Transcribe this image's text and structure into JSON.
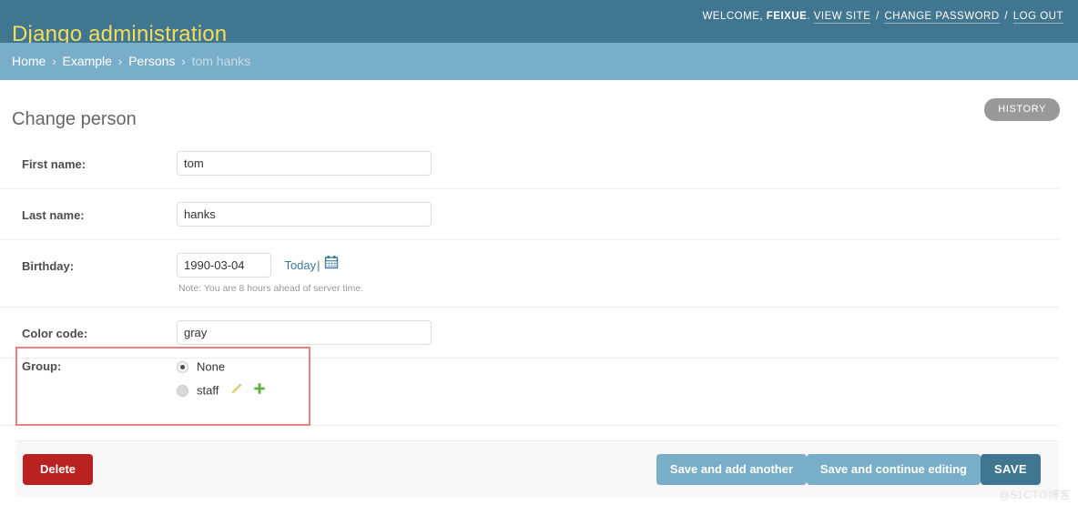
{
  "header": {
    "site_name": "Django administration",
    "welcome_prefix": "WELCOME,",
    "username": "FEIXUE",
    "username_suffix": ".",
    "view_site": "VIEW SITE",
    "sep1": "/",
    "change_password": "CHANGE PASSWORD",
    "sep2": "/",
    "log_out": "LOG OUT",
    "bg_color": "#417690",
    "title_color": "#f5dd5d"
  },
  "breadcrumbs": {
    "home": "Home",
    "sep": "›",
    "app": "Example",
    "model": "Persons",
    "current": "tom hanks",
    "bg_color": "#79aec8"
  },
  "content": {
    "title": "Change person",
    "history_button": "HISTORY"
  },
  "form": {
    "rows": [
      {
        "label": "First name:",
        "value": "tom",
        "type": "text"
      },
      {
        "label": "Last name:",
        "value": "hanks",
        "type": "text"
      },
      {
        "label": "Birthday:",
        "value": "1990-03-04",
        "type": "date",
        "today_link": "Today",
        "pipe": "|",
        "calendar_icon": "calendar-icon",
        "help_text": "Note: You are 8 hours ahead of server time."
      },
      {
        "label": "Color code:",
        "value": "gray",
        "type": "text"
      }
    ],
    "group": {
      "label": "Group:",
      "highlight_color": "#f08080",
      "options": [
        {
          "label": "None",
          "checked": true
        },
        {
          "label": "staff",
          "checked": false
        }
      ],
      "edit_icon": "pencil-icon",
      "add_icon": "plus-icon",
      "edit_icon_color": "#efb80b",
      "add_icon_color": "#5fb339"
    }
  },
  "submit_row": {
    "delete_label": "Delete",
    "save_add_another_label": "Save and add another",
    "save_continue_label": "Save and continue editing",
    "save_label": "SAVE",
    "delete_color": "#ba2121",
    "save_color": "#79aec8",
    "save_default_color": "#417690"
  },
  "watermark": {
    "text": "@51CTO博客"
  }
}
